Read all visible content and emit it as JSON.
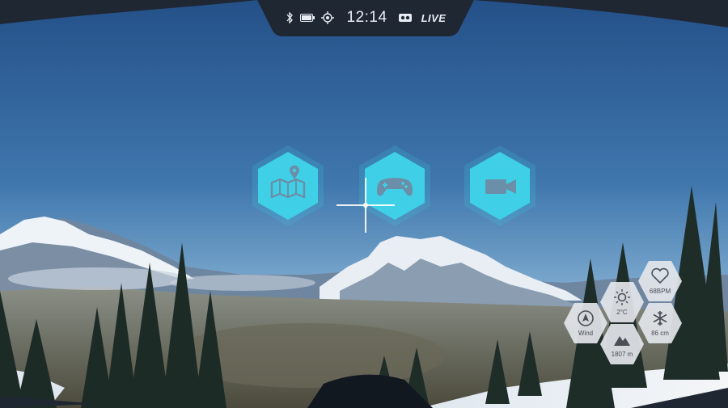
{
  "status_bar": {
    "time": "12:14",
    "live": "LIVE",
    "icons": [
      "bluetooth-icon",
      "battery-icon",
      "gps-icon",
      "vr-headset-icon"
    ]
  },
  "menu": {
    "accent": "#3fd0e8",
    "items": [
      {
        "name": "map-button",
        "icon": "map-icon"
      },
      {
        "name": "game-button",
        "icon": "gamepad-icon"
      },
      {
        "name": "video-button",
        "icon": "video-camera-icon"
      }
    ]
  },
  "stats": {
    "heart_rate": "68BPM",
    "temperature": "2°C",
    "wind": "Wind",
    "snow_depth": "86 cm",
    "altitude": "1807 m",
    "icons": [
      "heart-icon",
      "sun-icon",
      "compass-icon",
      "snowflake-icon",
      "mountain-icon"
    ]
  },
  "colors": {
    "sky_top": "#2a5a92",
    "sky_bottom": "#8fb6d6",
    "frame": "#1f2733",
    "stat_tile": "#e3e6ea"
  }
}
